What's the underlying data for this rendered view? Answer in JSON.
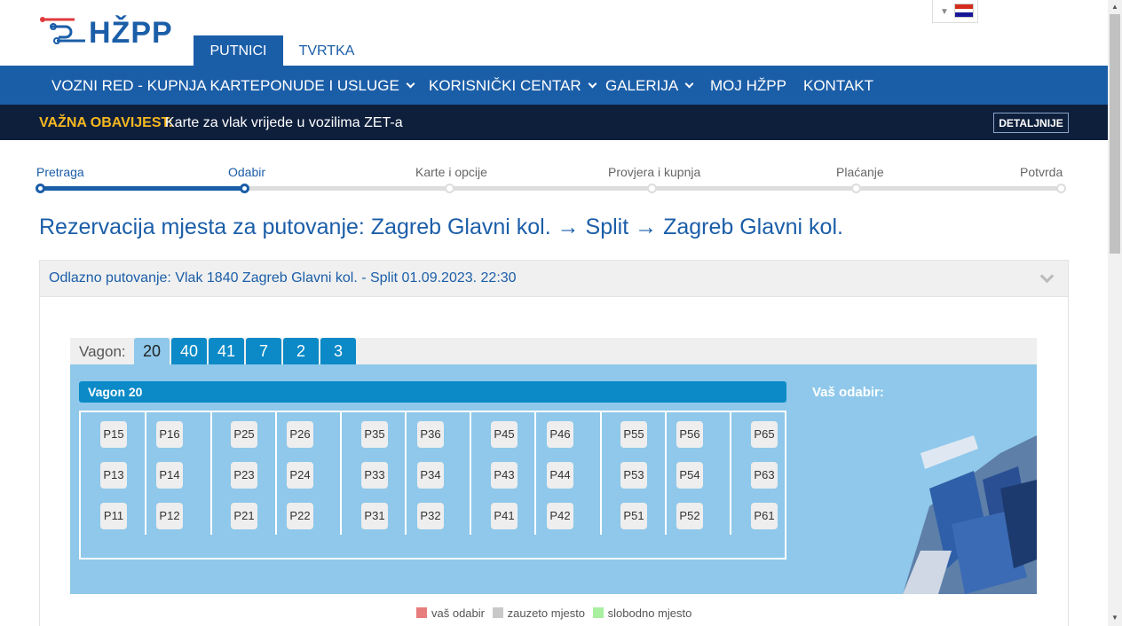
{
  "brand": {
    "logo_text": "HŽPP",
    "primary": "#1b5ea8"
  },
  "top_tabs": [
    {
      "label": "PUTNICI",
      "active": true
    },
    {
      "label": "TVRTKA",
      "active": false
    }
  ],
  "language": {
    "flag": "croatian-flag-icon"
  },
  "nav": {
    "items": [
      {
        "label": "VOZNI RED - KUPNJA KARTE",
        "dropdown": false
      },
      {
        "label": "PONUDE I USLUGE",
        "dropdown": true
      },
      {
        "label": "KORISNIČKI CENTAR",
        "dropdown": true
      },
      {
        "label": "GALERIJA",
        "dropdown": true
      },
      {
        "label": "MOJ HŽPP",
        "dropdown": false
      },
      {
        "label": "KONTAKT",
        "dropdown": false
      }
    ]
  },
  "notice": {
    "label": "VAŽNA OBAVIJEST:",
    "text": "Karte za vlak vrijede u vozilima ZET-a",
    "button": "DETALJNIJE"
  },
  "steps": [
    {
      "label": "Pretraga",
      "state": "done"
    },
    {
      "label": "Odabir",
      "state": "current"
    },
    {
      "label": "Karte i opcije",
      "state": "pending"
    },
    {
      "label": "Provjera i kupnja",
      "state": "pending"
    },
    {
      "label": "Plaćanje",
      "state": "pending"
    },
    {
      "label": "Potvrda",
      "state": "pending"
    }
  ],
  "heading": "Rezervacija mjesta za putovanje: Zagreb Glavni kol. → Split → Zagreb Glavni kol.",
  "panel": {
    "title": "Odlazno putovanje: Vlak 1840 Zagreb Glavni kol. - Split 01.09.2023. 22:30"
  },
  "wagon_selector": {
    "label": "Vagon:",
    "tabs": [
      "20",
      "40",
      "41",
      "7",
      "2",
      "3"
    ],
    "selected": "20"
  },
  "wagon": {
    "title": "Vagon 20",
    "your_choice_label": "Vaš odabir:",
    "seat_rows": [
      [
        "P15",
        "P16",
        "P25",
        "P26",
        "P35",
        "P36",
        "P45",
        "P46",
        "P55",
        "P56",
        "P65"
      ],
      [
        "P13",
        "P14",
        "P23",
        "P24",
        "P33",
        "P34",
        "P43",
        "P44",
        "P53",
        "P54",
        "P63"
      ],
      [
        "P11",
        "P12",
        "P21",
        "P22",
        "P31",
        "P32",
        "P41",
        "P42",
        "P51",
        "P52",
        "P61"
      ]
    ]
  },
  "legend": [
    {
      "label": "vaš odabir",
      "color": "#e87d7d"
    },
    {
      "label": "zauzeto mjesto",
      "color": "#c8c8c8"
    },
    {
      "label": "slobodno mjesto",
      "color": "#a8f0a0"
    }
  ]
}
